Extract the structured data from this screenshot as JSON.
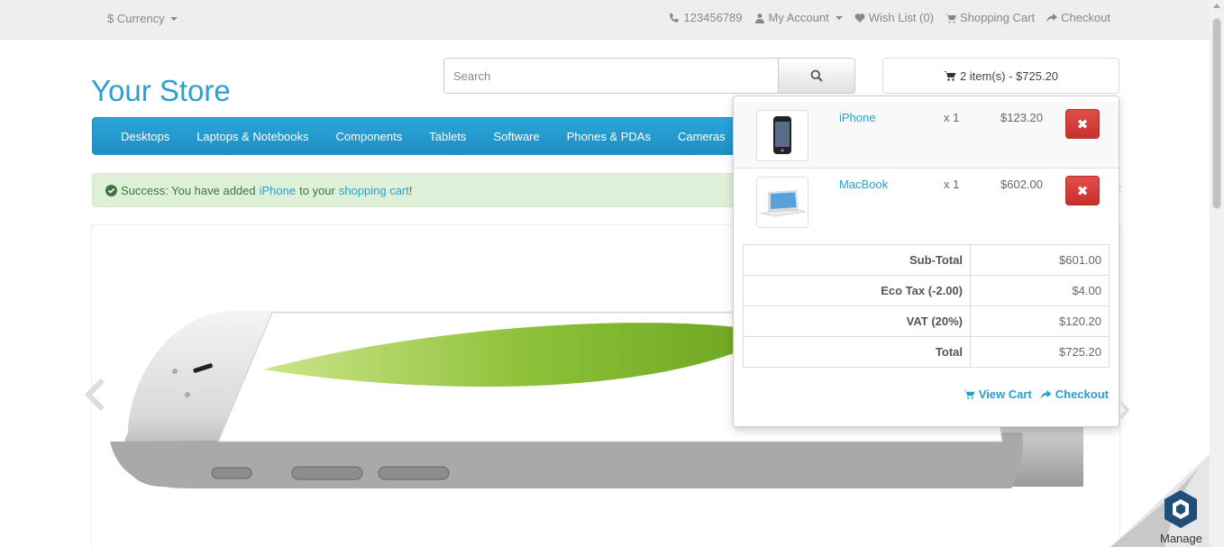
{
  "topbar": {
    "currency_label": "$ Currency",
    "phone": "123456789",
    "my_account": "My Account",
    "wish_list": "Wish List (0)",
    "shopping_cart": "Shopping Cart",
    "checkout": "Checkout"
  },
  "header": {
    "logo": "Your Store",
    "search_placeholder": "Search",
    "cart_summary": "2 item(s) - $725.20"
  },
  "menu": {
    "items": [
      "Desktops",
      "Laptops & Notebooks",
      "Components",
      "Tablets",
      "Software",
      "Phones & PDAs",
      "Cameras"
    ]
  },
  "alert": {
    "prefix": "Success: You have added",
    "product": "iPhone",
    "middle": "to your",
    "link": "shopping cart",
    "suffix": "!",
    "close": "×"
  },
  "cart_dropdown": {
    "items": [
      {
        "name": "iPhone",
        "qty": "x 1",
        "price": "$123.20"
      },
      {
        "name": "MacBook",
        "qty": "x 1",
        "price": "$602.00"
      }
    ],
    "totals": [
      {
        "label": "Sub-Total",
        "value": "$601.00"
      },
      {
        "label": "Eco Tax (-2.00)",
        "value": "$4.00"
      },
      {
        "label": "VAT (20%)",
        "value": "$120.20"
      },
      {
        "label": "Total",
        "value": "$725.20"
      }
    ],
    "view_cart": "View Cart",
    "checkout": "Checkout"
  },
  "widget": {
    "manage_label": "Manage"
  },
  "colors": {
    "link": "#23a1d1",
    "menu": "#229ac8",
    "danger": "#d9534f",
    "success_bg": "#dff0d8"
  }
}
